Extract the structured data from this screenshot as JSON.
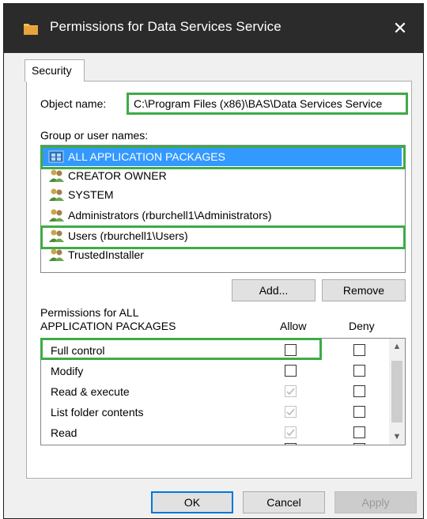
{
  "window": {
    "title": "Permissions for Data Services Service",
    "close_glyph": "✕"
  },
  "tabs": [
    {
      "label": "Security"
    }
  ],
  "object": {
    "label": "Object name:",
    "value": "C:\\Program Files (x86)\\BAS\\Data Services Service"
  },
  "groups": {
    "label": "Group or user names:",
    "items": [
      {
        "name": "ALL APPLICATION PACKAGES",
        "icon": "app-packages-icon",
        "selected": true
      },
      {
        "name": "CREATOR OWNER",
        "icon": "users-group-icon"
      },
      {
        "name": "SYSTEM",
        "icon": "users-group-icon"
      },
      {
        "name": "Administrators (rburchell1\\Administrators)",
        "icon": "users-group-icon"
      },
      {
        "name": "Users (rburchell1\\Users)",
        "icon": "users-group-icon"
      },
      {
        "name": "TrustedInstaller",
        "icon": "users-group-icon"
      }
    ]
  },
  "buttons": {
    "add": "Add...",
    "remove": "Remove",
    "ok": "OK",
    "cancel": "Cancel",
    "apply": "Apply"
  },
  "permissions": {
    "label_line1": "Permissions for ALL",
    "label_line2": "APPLICATION PACKAGES",
    "allow_header": "Allow",
    "deny_header": "Deny",
    "rows": [
      {
        "name": "Full control",
        "allow": false,
        "allow_disabled": false,
        "deny": false
      },
      {
        "name": "Modify",
        "allow": false,
        "allow_disabled": false,
        "deny": false
      },
      {
        "name": "Read & execute",
        "allow": true,
        "allow_disabled": true,
        "deny": false
      },
      {
        "name": "List folder contents",
        "allow": true,
        "allow_disabled": true,
        "deny": false
      },
      {
        "name": "Read",
        "allow": true,
        "allow_disabled": true,
        "deny": false
      }
    ]
  },
  "colors": {
    "highlight": "#3eab47",
    "selection": "#3399ff",
    "titlebar": "#2b2b2b"
  }
}
